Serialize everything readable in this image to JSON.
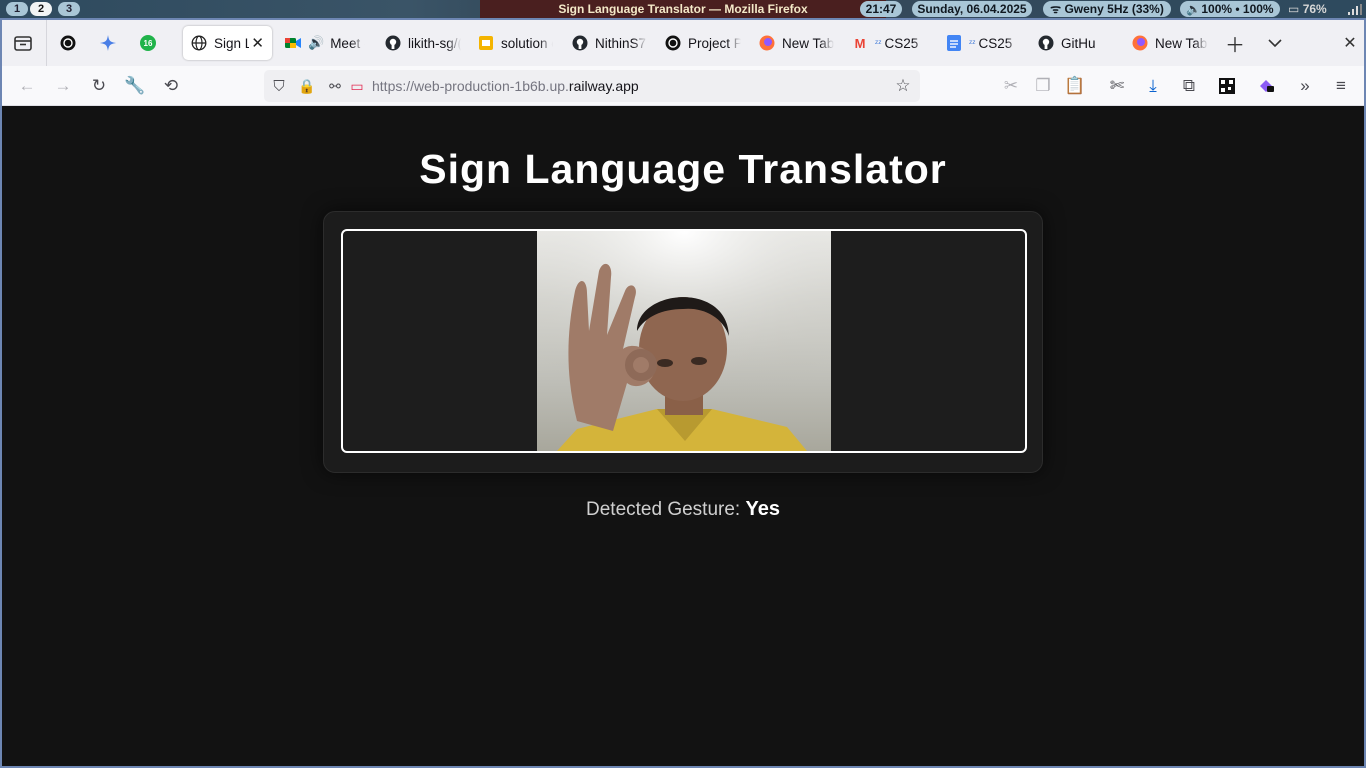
{
  "system_bar": {
    "workspaces": [
      "1",
      "2",
      "3"
    ],
    "active_workspace": "2",
    "window_title": "Sign Language Translator — Mozilla Firefox",
    "clock": "21:47",
    "date": "Sunday, 06.04.2025",
    "wifi": "Gweny 5Hz (33%)",
    "volume": "100% • 100%",
    "battery": "76%"
  },
  "browser": {
    "tabs": [
      {
        "label": "",
        "icon": "openai-icon"
      },
      {
        "label": "",
        "icon": "gemini-icon"
      },
      {
        "label": "16",
        "icon": "badge-icon"
      },
      {
        "label": "Sign L",
        "icon": "globe-icon",
        "active": true
      },
      {
        "label": "Meet -",
        "icon": "google-meet-icon",
        "audio": true
      },
      {
        "label": "likith-sg/(",
        "icon": "github-icon"
      },
      {
        "label": "solution c",
        "icon": "google-slides-icon"
      },
      {
        "label": "NithinS7",
        "icon": "github-icon"
      },
      {
        "label": "Project P",
        "icon": "openai-icon"
      },
      {
        "label": "New Tab",
        "icon": "firefox-icon"
      },
      {
        "label": "CS25",
        "icon": "gmail-icon"
      },
      {
        "label": "CS25",
        "icon": "google-docs-icon"
      },
      {
        "label": "GitHu",
        "icon": "github-icon"
      },
      {
        "label": "New Tab",
        "icon": "firefox-icon"
      }
    ],
    "url_prefix": "https://web-production-1b6b.up.",
    "url_domain": "railway.app"
  },
  "page": {
    "title": "Sign Language Translator",
    "gesture_label": "Detected Gesture: ",
    "gesture_value": "Yes"
  },
  "colors": {
    "page_background": "#121212",
    "card_background": "#1c1c1c",
    "video_border": "#ffffff",
    "accent_frame": "#6d86b3"
  }
}
